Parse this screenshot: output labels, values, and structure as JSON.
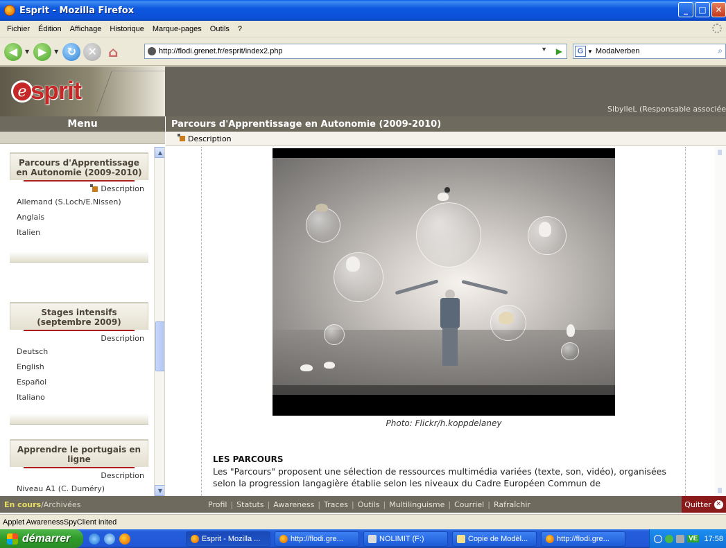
{
  "window": {
    "title": "Esprit - Mozilla Firefox"
  },
  "menu": [
    "Fichier",
    "Édition",
    "Affichage",
    "Historique",
    "Marque-pages",
    "Outils",
    "?"
  ],
  "nav": {
    "url": "http://flodi.grenet.fr/esprit/index2.php",
    "search_engine_label": "G",
    "search_value": "Modalverben"
  },
  "app": {
    "logo_letter": "e",
    "logo_text": "sprit",
    "user": "SibylleL (Responsable associée",
    "menu_title": "Menu",
    "content_title": "Parcours d'Apprentissage en Autonomie (2009-2010)",
    "subtab": "Description"
  },
  "sidebar": {
    "boxes": [
      {
        "title": "Parcours d'Apprentissage en Autonomie (2009-2010)",
        "description": "Description",
        "items": [
          "Allemand (S.Loch/E.Nissen)",
          "Anglais",
          "Italien"
        ]
      },
      {
        "title": "Stages intensifs (septembre 2009)",
        "description": "Description",
        "items": [
          "Deutsch",
          "English",
          "Español",
          "Italiano"
        ]
      },
      {
        "title": "Apprendre le portugais en ligne",
        "description": "Description",
        "items": [
          "Niveau A1 (C. Duméry)"
        ]
      }
    ]
  },
  "content": {
    "caption": "Photo: Flickr/h.koppdelaney",
    "section_title": "LES PARCOURS",
    "paragraph": "Les \"Parcours\" proposent une sélection de ressources multimédia variées (texte, son, vidéo), organisées selon la progression langagière établie selon les niveaux du Cadre Européen Commun de"
  },
  "bottom": {
    "current": "En cours",
    "archived": "/Archivées",
    "links": [
      "Profil",
      "Statuts",
      "Awareness",
      "Traces",
      "Outils",
      "Multilinguisme",
      "Courriel",
      "Rafraîchir"
    ],
    "quit": "Quitter"
  },
  "status": "Applet AwarenessSpyClient inited",
  "taskbar": {
    "start": "démarrer",
    "tasks": [
      "Esprit - Mozilla ...",
      "http://flodi.gre...",
      "NOLIMIT (F:)",
      "Copie de Modèl...",
      "http://flodi.gre..."
    ],
    "tray_label": "VE",
    "time": "17:58"
  }
}
